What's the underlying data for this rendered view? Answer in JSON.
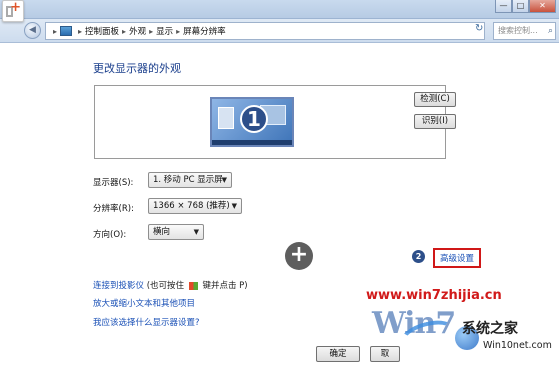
{
  "window": {
    "buttons": {
      "minimize": "—",
      "maximize": "□",
      "close": "✕"
    }
  },
  "breadcrumb": {
    "items": [
      "控制面板",
      "外观",
      "显示",
      "屏幕分辨率"
    ],
    "separator": "▸",
    "lead": "▸"
  },
  "search": {
    "placeholder": "搜索控制..."
  },
  "main": {
    "heading": "更改显示器的外观",
    "monitor_number": "1",
    "detect_button": "检测(C)",
    "identify_button": "识别(I)",
    "display_label": "显示器(S):",
    "display_value": "1. 移动 PC 显示屏",
    "resolution_label": "分辨率(R):",
    "resolution_value": "1366 × 768 (推荐)",
    "orientation_label": "方向(O):",
    "orientation_value": "横向",
    "step_number": "2",
    "advanced_link": "高级设置",
    "plus_symbol": "+"
  },
  "links": {
    "projector_link": "连接到投影仪",
    "projector_hint_pre": "(也可按住",
    "projector_hint_post": "键并点击 P)",
    "text_size_link": "放大或缩小文本和其他项目",
    "help_link": "我应该选择什么显示器设置?"
  },
  "footer": {
    "ok_button": "确定",
    "cancel_button": "取"
  },
  "watermark": {
    "url": "www.win7zhijia.cn",
    "logo": "Win7",
    "brand": "系统之家",
    "site": "Win10net.com"
  },
  "colors": {
    "heading": "#1a3e8c",
    "link": "#1a50b6",
    "highlight_border": "#d01818",
    "watermark_url": "#d11a1a"
  },
  "icons": {
    "back": "back-arrow-icon",
    "forward": "forward-arrow-icon",
    "control_panel": "control-panel-icon",
    "refresh": "refresh-icon",
    "search": "search-icon",
    "windows_key": "windows-logo-icon"
  }
}
